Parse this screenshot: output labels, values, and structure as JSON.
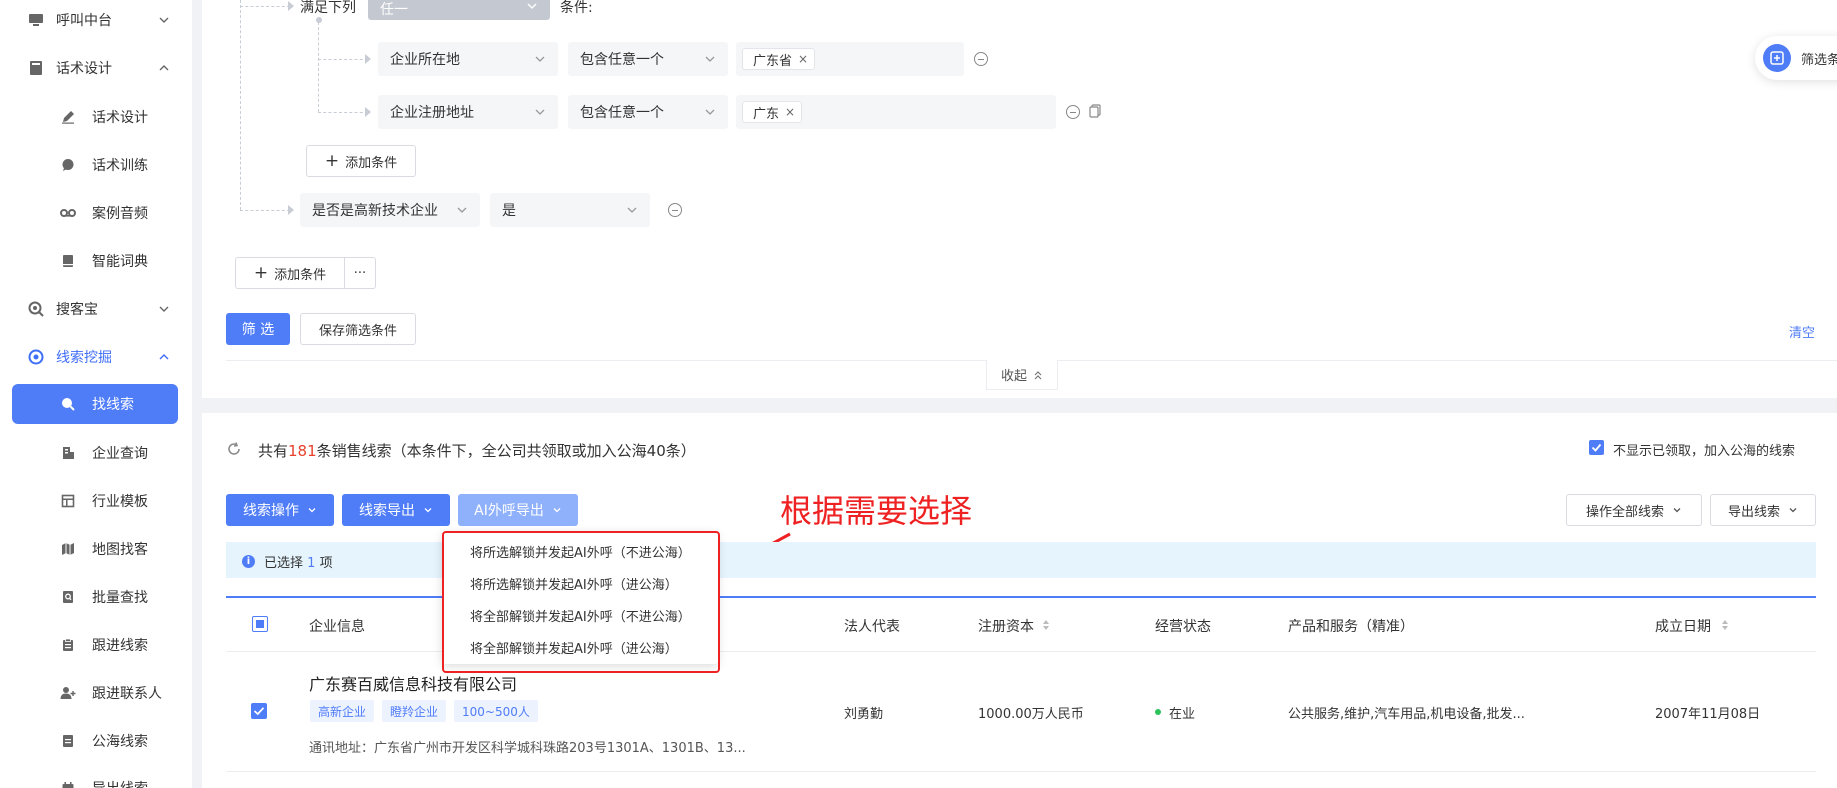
{
  "sidebar": {
    "groups": {
      "call_center": "呼叫中台",
      "script_design": "话术设计",
      "search_treasure": "搜客宝",
      "lead_mining": "线索挖掘"
    },
    "sub_items": {
      "script_design": "话术设计",
      "script_training": "话术训练",
      "case_audio": "案例音频",
      "smart_dictionary": "智能词典",
      "find_leads": "找线索",
      "company_query": "企业查询",
      "industry_template": "行业模板",
      "map_search": "地图找客",
      "batch_search": "批量查找",
      "follow_leads": "跟进线索",
      "follow_contacts": "跟进联系人",
      "public_leads": "公海线索",
      "export_leads": "导出线索"
    }
  },
  "filter": {
    "meets_label": "满足下列",
    "meets_value": "任一",
    "condition_label": "条件:",
    "row1": {
      "field": "企业所在地",
      "operator": "包含任意一个",
      "tag": "广东省"
    },
    "row2": {
      "field": "企业注册地址",
      "operator": "包含任意一个",
      "tag": "广东"
    },
    "add_condition_inner": "添加条件",
    "row3": {
      "field": "是否是高新技术企业",
      "value": "是"
    },
    "add_condition_outer": "添加条件",
    "more": "···",
    "filter_button": "筛 选",
    "save_button": "保存筛选条件",
    "clear": "清空",
    "collapse": "收起",
    "floating_filter": "筛选条"
  },
  "results": {
    "summary_prefix": "共有",
    "summary_count": "181",
    "summary_suffix": "条销售线索（本条件下，全公司共领取或加入公海40条）",
    "hide_claimed_label": "不显示已领取，加入公海的线索",
    "toolbar": {
      "lead_ops": "线索操作",
      "lead_export": "线索导出",
      "ai_export": "AI外呼导出",
      "operate_all": "操作全部线索",
      "export_leads": "导出线索"
    },
    "dropdown": [
      "将所选解锁并发起AI外呼（不进公海）",
      "将所选解锁并发起AI外呼（进公海）",
      "将全部解锁并发起AI外呼（不进公海）",
      "将全部解锁并发起AI外呼（进公海）"
    ],
    "annotation": "根据需要选择",
    "selected_prefix": "已选择",
    "selected_count": "1",
    "selected_suffix": "项",
    "columns": {
      "company": "企业信息",
      "legal_rep": "法人代表",
      "capital": "注册资本",
      "status": "经营状态",
      "products": "产品和服务（精准）",
      "founded": "成立日期"
    },
    "rows": [
      {
        "company": "广东赛百威信息科技有限公司",
        "tags": [
          "高新企业",
          "瞪羚企业",
          "100~500人"
        ],
        "address": "通讯地址：广东省广州市开发区科学城科珠路203号1301A、1301B、13...",
        "legal_rep": "刘勇勤",
        "capital": "1000.00万人民币",
        "status": "在业",
        "products": "公共服务,维护,汽车用品,机电设备,批发...",
        "founded": "2007年11月08日"
      }
    ]
  },
  "colors": {
    "primary": "#4f7cf7",
    "annotation": "#ee2222",
    "accent_red": "#e8412c",
    "status_green": "#2ec25b"
  }
}
